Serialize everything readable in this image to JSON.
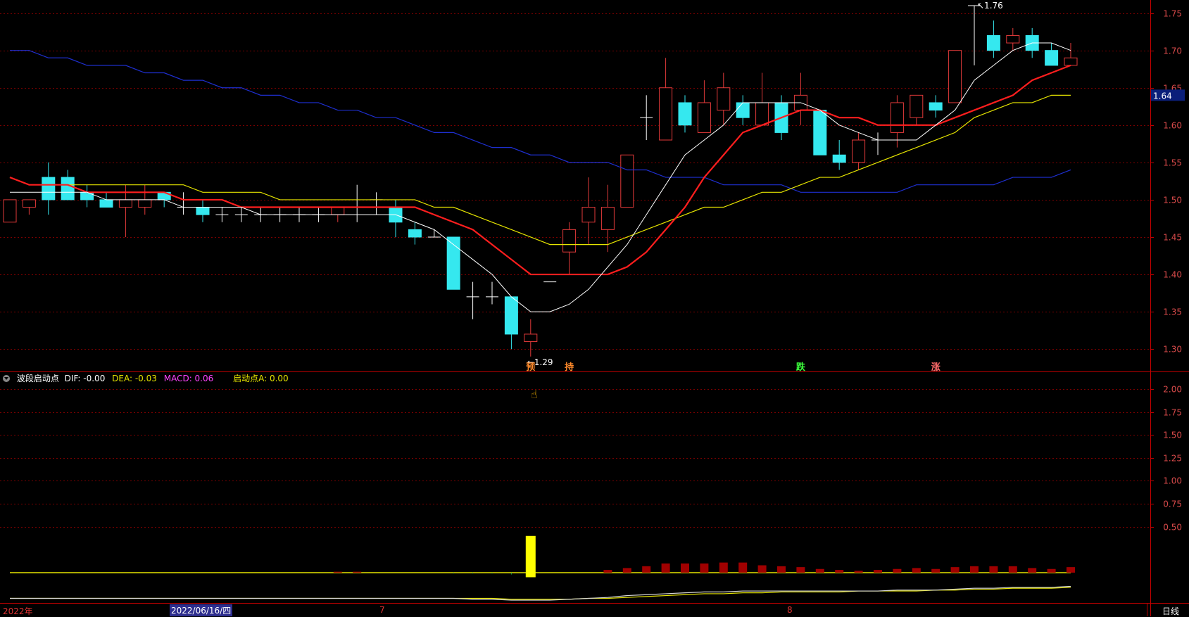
{
  "colors": {
    "background": "#000000",
    "grid": "#7a0000",
    "axis_text": "#d84a4a",
    "up": "#e23a3a",
    "down": "#35e8ef",
    "flat": "#ffffff",
    "ma5": "#ffffff",
    "ma10": "#ff1e1e",
    "ma20": "#e5e400",
    "ma60": "#1e2fd0",
    "dif": "#d8d8d8",
    "dea": "#e5e400",
    "macd_label": "#ff44ff",
    "signal": "#ffff00",
    "current_price_bg": "#0b1f7a"
  },
  "indicator": {
    "name": "波段启动点",
    "dif": "DIF: -0.00",
    "dea": "DEA: -0.03",
    "macd": "MACD: 0.06",
    "start": "启动点A: 0.00"
  },
  "date_axis": {
    "year": "2022年",
    "cursor": "2022/06/16/四",
    "m7": "7",
    "m8": "8"
  },
  "period": "日线",
  "icons": [
    "collapse-icon",
    "hand-cursor-icon"
  ],
  "chart_data": [
    {
      "type": "candlestick",
      "y_ticks": [
        "1.30",
        "1.35",
        "1.40",
        "1.45",
        "1.50",
        "1.55",
        "1.60",
        "1.65",
        "1.70",
        "1.75"
      ],
      "ylim": [
        1.27,
        1.76
      ],
      "current_price": "1.64",
      "high_label": "1.76",
      "low_label": "1.29",
      "candles": [
        [
          1.47,
          1.5,
          1.47,
          1.5
        ],
        [
          1.49,
          1.5,
          1.48,
          1.5
        ],
        [
          1.53,
          1.55,
          1.48,
          1.5
        ],
        [
          1.53,
          1.54,
          1.5,
          1.5
        ],
        [
          1.51,
          1.52,
          1.49,
          1.5
        ],
        [
          1.5,
          1.51,
          1.49,
          1.49
        ],
        [
          1.49,
          1.52,
          1.45,
          1.5
        ],
        [
          1.49,
          1.52,
          1.48,
          1.5
        ],
        [
          1.51,
          1.51,
          1.49,
          1.5
        ],
        [
          1.49,
          1.51,
          1.48,
          1.49
        ],
        [
          1.49,
          1.5,
          1.47,
          1.48
        ],
        [
          1.48,
          1.49,
          1.47,
          1.48
        ],
        [
          1.48,
          1.49,
          1.47,
          1.48
        ],
        [
          1.48,
          1.49,
          1.47,
          1.48
        ],
        [
          1.48,
          1.49,
          1.47,
          1.48
        ],
        [
          1.48,
          1.49,
          1.47,
          1.48
        ],
        [
          1.48,
          1.49,
          1.47,
          1.48
        ],
        [
          1.48,
          1.49,
          1.47,
          1.49
        ],
        [
          1.49,
          1.52,
          1.47,
          1.49
        ],
        [
          1.5,
          1.51,
          1.48,
          1.5
        ],
        [
          1.49,
          1.5,
          1.45,
          1.47
        ],
        [
          1.46,
          1.47,
          1.44,
          1.45
        ],
        [
          1.45,
          1.46,
          1.45,
          1.45
        ],
        [
          1.45,
          1.45,
          1.38,
          1.38
        ],
        [
          1.37,
          1.39,
          1.34,
          1.37
        ],
        [
          1.37,
          1.39,
          1.36,
          1.37
        ],
        [
          1.37,
          1.37,
          1.3,
          1.32
        ],
        [
          1.31,
          1.34,
          1.29,
          1.32
        ],
        [
          1.39,
          1.39,
          1.39,
          1.39
        ],
        [
          1.43,
          1.47,
          1.4,
          1.46
        ],
        [
          1.47,
          1.53,
          1.44,
          1.49
        ],
        [
          1.46,
          1.52,
          1.43,
          1.49
        ],
        [
          1.49,
          1.56,
          1.49,
          1.56
        ],
        [
          1.61,
          1.64,
          1.58,
          1.61
        ],
        [
          1.58,
          1.69,
          1.58,
          1.65
        ],
        [
          1.63,
          1.64,
          1.59,
          1.6
        ],
        [
          1.59,
          1.66,
          1.59,
          1.63
        ],
        [
          1.62,
          1.67,
          1.6,
          1.65
        ],
        [
          1.63,
          1.64,
          1.6,
          1.61
        ],
        [
          1.6,
          1.67,
          1.6,
          1.63
        ],
        [
          1.63,
          1.64,
          1.58,
          1.59
        ],
        [
          1.62,
          1.67,
          1.6,
          1.64
        ],
        [
          1.62,
          1.62,
          1.56,
          1.56
        ],
        [
          1.56,
          1.58,
          1.54,
          1.55
        ],
        [
          1.55,
          1.59,
          1.54,
          1.58
        ],
        [
          1.58,
          1.59,
          1.56,
          1.58
        ],
        [
          1.59,
          1.64,
          1.57,
          1.63
        ],
        [
          1.61,
          1.64,
          1.6,
          1.64
        ],
        [
          1.63,
          1.64,
          1.61,
          1.62
        ],
        [
          1.63,
          1.7,
          1.63,
          1.7
        ],
        [
          1.76,
          1.76,
          1.68,
          1.76
        ],
        [
          1.72,
          1.74,
          1.69,
          1.7
        ],
        [
          1.71,
          1.73,
          1.7,
          1.72
        ],
        [
          1.72,
          1.73,
          1.69,
          1.7
        ],
        [
          1.7,
          1.71,
          1.68,
          1.68
        ],
        [
          1.68,
          1.71,
          1.68,
          1.69
        ]
      ],
      "ma5": [
        1.51,
        1.51,
        1.51,
        1.51,
        1.51,
        1.5,
        1.5,
        1.5,
        1.5,
        1.49,
        1.49,
        1.49,
        1.49,
        1.48,
        1.48,
        1.48,
        1.48,
        1.48,
        1.48,
        1.48,
        1.48,
        1.47,
        1.46,
        1.44,
        1.42,
        1.4,
        1.37,
        1.35,
        1.35,
        1.36,
        1.38,
        1.41,
        1.44,
        1.48,
        1.52,
        1.56,
        1.58,
        1.6,
        1.63,
        1.63,
        1.63,
        1.63,
        1.62,
        1.6,
        1.59,
        1.58,
        1.58,
        1.58,
        1.6,
        1.62,
        1.66,
        1.68,
        1.7,
        1.71,
        1.71,
        1.7
      ],
      "ma10": [
        1.53,
        1.52,
        1.52,
        1.52,
        1.51,
        1.51,
        1.51,
        1.51,
        1.51,
        1.5,
        1.5,
        1.5,
        1.49,
        1.49,
        1.49,
        1.49,
        1.49,
        1.49,
        1.49,
        1.49,
        1.49,
        1.49,
        1.48,
        1.47,
        1.46,
        1.44,
        1.42,
        1.4,
        1.4,
        1.4,
        1.4,
        1.4,
        1.41,
        1.43,
        1.46,
        1.49,
        1.53,
        1.56,
        1.59,
        1.6,
        1.61,
        1.62,
        1.62,
        1.61,
        1.61,
        1.6,
        1.6,
        1.6,
        1.6,
        1.61,
        1.62,
        1.63,
        1.64,
        1.66,
        1.67,
        1.68
      ],
      "ma20": [
        1.53,
        1.52,
        1.52,
        1.52,
        1.52,
        1.52,
        1.52,
        1.52,
        1.52,
        1.52,
        1.51,
        1.51,
        1.51,
        1.51,
        1.5,
        1.5,
        1.5,
        1.5,
        1.5,
        1.5,
        1.5,
        1.5,
        1.49,
        1.49,
        1.48,
        1.47,
        1.46,
        1.45,
        1.44,
        1.44,
        1.44,
        1.44,
        1.45,
        1.46,
        1.47,
        1.48,
        1.49,
        1.49,
        1.5,
        1.51,
        1.51,
        1.52,
        1.53,
        1.53,
        1.54,
        1.55,
        1.56,
        1.57,
        1.58,
        1.59,
        1.61,
        1.62,
        1.63,
        1.63,
        1.64,
        1.64
      ],
      "ma60": [
        1.7,
        1.7,
        1.69,
        1.69,
        1.68,
        1.68,
        1.68,
        1.67,
        1.67,
        1.66,
        1.66,
        1.65,
        1.65,
        1.64,
        1.64,
        1.63,
        1.63,
        1.62,
        1.62,
        1.61,
        1.61,
        1.6,
        1.59,
        1.59,
        1.58,
        1.57,
        1.57,
        1.56,
        1.56,
        1.55,
        1.55,
        1.55,
        1.54,
        1.54,
        1.53,
        1.53,
        1.53,
        1.52,
        1.52,
        1.52,
        1.52,
        1.51,
        1.51,
        1.51,
        1.51,
        1.51,
        1.51,
        1.52,
        1.52,
        1.52,
        1.52,
        1.52,
        1.53,
        1.53,
        1.53,
        1.54
      ]
    },
    {
      "type": "bar",
      "y_ticks": [
        "0.50",
        "0.75",
        "1.00",
        "1.25",
        "1.50",
        "1.75",
        "2.00"
      ],
      "ylim": [
        -0.33,
        2.1
      ],
      "signal_index": 27,
      "signal_value": 0.4,
      "macd": [
        0,
        0,
        0,
        0,
        0,
        0,
        0,
        0,
        0,
        0,
        0,
        0,
        0,
        0,
        0,
        0,
        0,
        0.01,
        0.01,
        0,
        0,
        0,
        0,
        -0.01,
        -0.01,
        -0.01,
        -0.02,
        -0.02,
        0,
        0,
        0,
        0.03,
        0.05,
        0.07,
        0.1,
        0.1,
        0.1,
        0.11,
        0.11,
        0.08,
        0.07,
        0.06,
        0.04,
        0.03,
        0.02,
        0.03,
        0.04,
        0.05,
        0.04,
        0.06,
        0.07,
        0.07,
        0.07,
        0.05,
        0.04,
        0.06
      ],
      "dif": [
        -0.28,
        -0.28,
        -0.28,
        -0.28,
        -0.28,
        -0.28,
        -0.28,
        -0.28,
        -0.28,
        -0.28,
        -0.28,
        -0.28,
        -0.28,
        -0.28,
        -0.28,
        -0.28,
        -0.28,
        -0.28,
        -0.28,
        -0.28,
        -0.28,
        -0.28,
        -0.28,
        -0.28,
        -0.29,
        -0.29,
        -0.3,
        -0.3,
        -0.3,
        -0.29,
        -0.28,
        -0.27,
        -0.25,
        -0.24,
        -0.23,
        -0.22,
        -0.21,
        -0.21,
        -0.2,
        -0.2,
        -0.2,
        -0.2,
        -0.2,
        -0.2,
        -0.2,
        -0.2,
        -0.19,
        -0.19,
        -0.19,
        -0.18,
        -0.17,
        -0.17,
        -0.16,
        -0.16,
        -0.16,
        -0.15
      ],
      "dea": [
        -0.28,
        -0.28,
        -0.28,
        -0.28,
        -0.28,
        -0.28,
        -0.28,
        -0.28,
        -0.28,
        -0.28,
        -0.28,
        -0.28,
        -0.28,
        -0.28,
        -0.28,
        -0.28,
        -0.28,
        -0.28,
        -0.28,
        -0.28,
        -0.28,
        -0.28,
        -0.28,
        -0.28,
        -0.28,
        -0.28,
        -0.29,
        -0.29,
        -0.29,
        -0.29,
        -0.28,
        -0.28,
        -0.27,
        -0.26,
        -0.25,
        -0.24,
        -0.23,
        -0.23,
        -0.22,
        -0.22,
        -0.21,
        -0.21,
        -0.21,
        -0.21,
        -0.2,
        -0.2,
        -0.2,
        -0.2,
        -0.19,
        -0.19,
        -0.18,
        -0.18,
        -0.17,
        -0.17,
        -0.17,
        -0.16
      ]
    }
  ],
  "signals": [
    {
      "index": 27,
      "text": "预",
      "color": "#ff8a2a"
    },
    {
      "index": 29,
      "text": "持",
      "color": "#ff8a2a"
    },
    {
      "index": 41,
      "text": "跌",
      "color": "#3cff3c"
    },
    {
      "index": 48,
      "text": "涨",
      "color": "#ff6a6a"
    }
  ]
}
